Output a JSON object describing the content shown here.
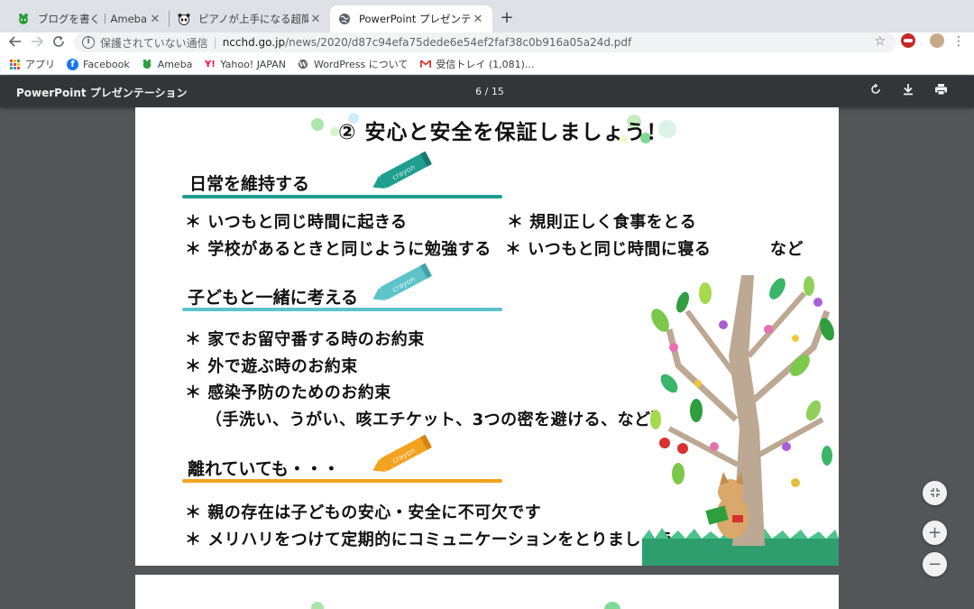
{
  "tabs": [
    {
      "title": "ブログを書く｜Ameba (アメーバ)",
      "icon": "ameba-icon"
    },
    {
      "title": "ピアノが上手になる超簡単ヒント集",
      "icon": "panda-icon"
    },
    {
      "title": "PowerPoint プレゼンテーション",
      "icon": "globe-icon"
    }
  ],
  "omnibox": {
    "security_label": "保護されていない通信",
    "host": "ncchd.go.jp",
    "path": "/news/2020/d87c94efa75dede6e54ef2faf38c0b916a05a24d.pdf"
  },
  "bookmarks": [
    {
      "label": "アプリ",
      "icon": "apps-icon"
    },
    {
      "label": "Facebook",
      "icon": "facebook-icon"
    },
    {
      "label": "Ameba",
      "icon": "ameba-icon"
    },
    {
      "label": "Yahoo! JAPAN",
      "icon": "yahoo-icon"
    },
    {
      "label": "WordPress について",
      "icon": "wordpress-icon"
    },
    {
      "label": "受信トレイ (1,081)...",
      "icon": "gmail-icon"
    }
  ],
  "pdf": {
    "title": "PowerPoint プレゼンテーション",
    "page_indicator": "6 / 15"
  },
  "slide": {
    "title": "②  安心と安全を保証しましょう！",
    "section1": {
      "heading": "日常を維持する",
      "items": [
        "＊ いつもと同じ時間に起きる",
        "＊ 規則正しく食事をとる",
        "＊ 学校があるときと同じように勉強する",
        "＊ いつもと同じ時間に寝る",
        "など"
      ]
    },
    "section2": {
      "heading": "子どもと一緒に考える",
      "items": [
        "＊ 家でお留守番する時のお約束",
        "＊ 外で遊ぶ時のお約束",
        "＊ 感染予防のためのお約束",
        "（手洗い、うがい、咳エチケット、3つの密を避ける、など）"
      ]
    },
    "section3": {
      "heading": "離れていても・・・",
      "items": [
        "＊ 親の存在は子どもの安心・安全に不可欠です",
        "＊ メリハリをつけて定期的にコミュニケーションをとりましょう"
      ]
    },
    "crayon_label": "crayon"
  },
  "colors": {
    "teal": "#1f9e8f",
    "aqua": "#5ec3c9",
    "orange": "#f3a21f",
    "pdf_toolbar": "#323639",
    "viewer_bg": "#525659"
  }
}
